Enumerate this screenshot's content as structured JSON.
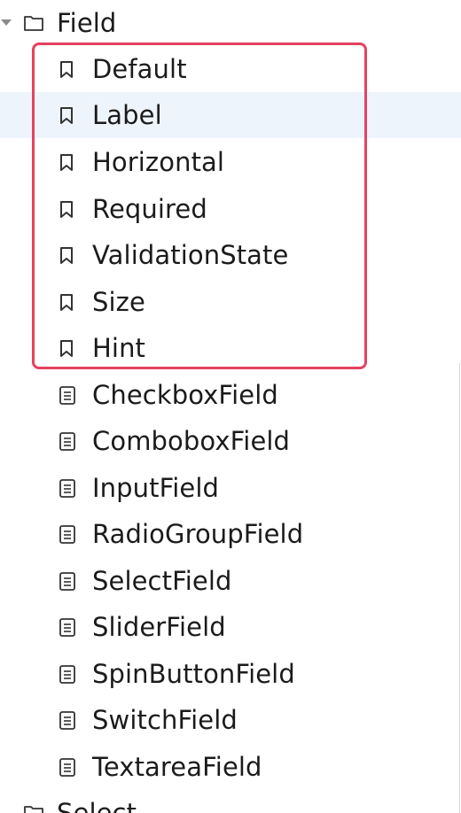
{
  "tree": {
    "folder_label": "Field",
    "stories": [
      {
        "label": "Default"
      },
      {
        "label": "Label"
      },
      {
        "label": "Horizontal"
      },
      {
        "label": "Required"
      },
      {
        "label": "ValidationState"
      },
      {
        "label": "Size"
      },
      {
        "label": "Hint"
      }
    ],
    "docs": [
      {
        "label": "CheckboxField"
      },
      {
        "label": "ComboboxField"
      },
      {
        "label": "InputField"
      },
      {
        "label": "RadioGroupField"
      },
      {
        "label": "SelectField"
      },
      {
        "label": "SliderField"
      },
      {
        "label": "SpinButtonField"
      },
      {
        "label": "SwitchField"
      },
      {
        "label": "TextareaField"
      }
    ],
    "next_folder_label": "Select"
  },
  "colors": {
    "highlight_border": "#e5425f",
    "selected_bg": "#eef4fc",
    "text": "#1b1b1b"
  }
}
